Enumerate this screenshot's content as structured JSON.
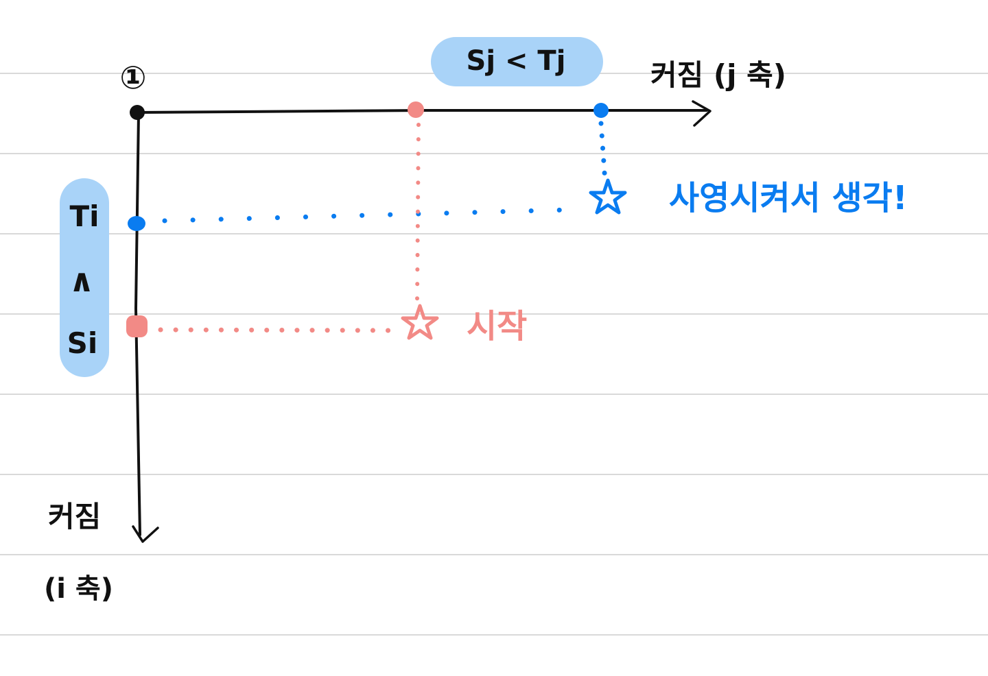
{
  "colors": {
    "ruled_line": "#d9d9d9",
    "ink": "#111111",
    "blue": "#0a7cf0",
    "pink": "#f28a86",
    "highlight": "#a9d3f8"
  },
  "labels": {
    "circled_one": "①",
    "top_highlight": "Sj < Tj",
    "x_axis_label": "커짐 (j 축)",
    "y_axis_label_line1": "커짐",
    "y_axis_label_line2": "(i 축)",
    "left_highlight_top": "Ti",
    "left_highlight_mid": "∧",
    "left_highlight_bottom": "Si",
    "blue_note": "사영시켜서 생각!",
    "pink_note": "시작"
  },
  "icons": {
    "blue_star": "star-icon",
    "pink_star": "star-icon"
  }
}
